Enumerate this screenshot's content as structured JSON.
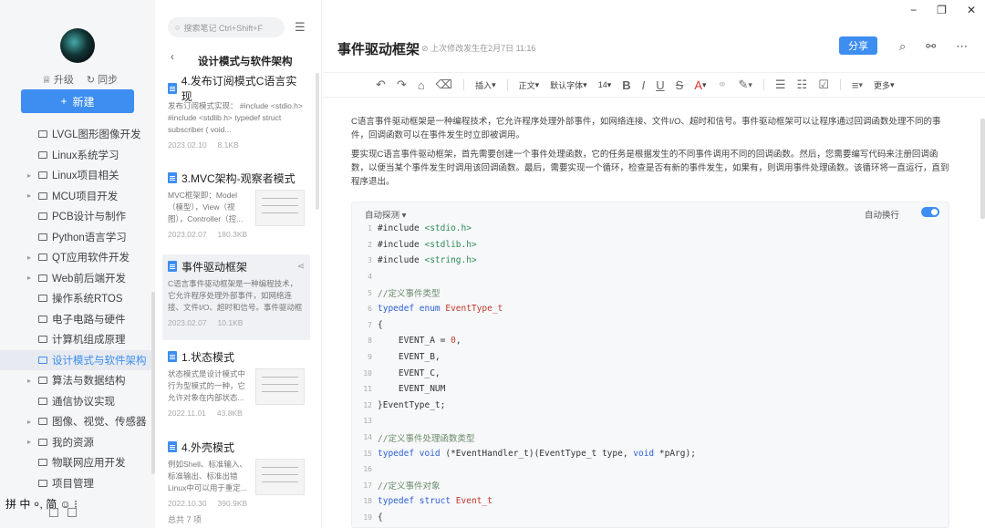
{
  "sidebar": {
    "upgrade": "升级",
    "sync": "同步",
    "new_button": "新建",
    "folders": [
      {
        "label": "LVGL图形图像开发",
        "expandable": false
      },
      {
        "label": "Linux系统学习",
        "expandable": false
      },
      {
        "label": "Linux项目相关",
        "expandable": true
      },
      {
        "label": "MCU项目开发",
        "expandable": true
      },
      {
        "label": "PCB设计与制作",
        "expandable": false
      },
      {
        "label": "Python语言学习",
        "expandable": false
      },
      {
        "label": "QT应用软件开发",
        "expandable": true
      },
      {
        "label": "Web前后端开发",
        "expandable": true
      },
      {
        "label": "操作系统RTOS",
        "expandable": false
      },
      {
        "label": "电子电路与硬件",
        "expandable": false
      },
      {
        "label": "计算机组成原理",
        "expandable": false
      },
      {
        "label": "设计模式与软件架构",
        "expandable": false,
        "active": true
      },
      {
        "label": "算法与数据结构",
        "expandable": true
      },
      {
        "label": "通信协议实现",
        "expandable": false
      },
      {
        "label": "图像、视觉、传感器",
        "expandable": true
      },
      {
        "label": "我的资源",
        "expandable": true
      },
      {
        "label": "物联网应用开发",
        "expandable": false
      },
      {
        "label": "项目管理",
        "expandable": false
      }
    ],
    "ime": "拼 中 ⸰, 简 ☺ ⁝"
  },
  "notelist": {
    "search_placeholder": "搜索笔记 Ctrl+Shift+F",
    "header": "设计模式与软件架构",
    "footer": "总共 7 项",
    "notes": [
      {
        "title": "4.发布订阅模式C语言实现",
        "snippet": "发布订阅模式实现： #include <stdio.h> #include <stdlib.h> typedef struct subscriber ( void...",
        "date": "2023.02.10",
        "size": "8.1KB",
        "thumb": false
      },
      {
        "title": "3.MVC架构-观察者模式",
        "snippet": "MVC框架即：Model（模型），View（视图），Controller（控...",
        "date": "2023.02.07",
        "size": "180.3KB",
        "thumb": true
      },
      {
        "title": "事件驱动框架",
        "snippet": "C语言事件驱动框架是一种编程技术，它允许程序处理外部事件，如网络连接、文件I/O、超时和信号。事件驱动框架可...",
        "date": "2023.02.07",
        "size": "10.1KB",
        "thumb": false,
        "active": true
      },
      {
        "title": "1.状态模式",
        "snippet": "状态模式是设计模式中行为型模式的一种，它允许对象在内部状态...",
        "date": "2022.11.01",
        "size": "43.8KB",
        "thumb": true
      },
      {
        "title": "4.外壳模式",
        "snippet": "例如Shell、标准输入、标准输出、标准出错 Linux中可以用于重定...",
        "date": "2022.10.30",
        "size": "390.9KB",
        "thumb": true
      }
    ]
  },
  "editor": {
    "title": "事件驱动框架",
    "modified": "上次修改发生在2月7日 11:16",
    "share": "分享",
    "toolbar": {
      "insert": "插入",
      "text": "正文",
      "font": "默认字体",
      "size": "14",
      "more": "更多"
    },
    "para1": "C语言事件驱动框架是一种编程技术，它允许程序处理外部事件，如网络连接、文件I/O、超时和信号。事件驱动框架可以让程序通过回调函数处理不同的事件，回调函数可以在事件发生时立即被调用。",
    "para2": "要实现C语言事件驱动框架，首先需要创建一个事件处理函数，它的任务是根据发生的不同事件调用不同的回调函数。然后，您需要编写代码来注册回调函数，以便当某个事件发生时调用该回调函数。最后，需要实现一个循环，检查是否有新的事件发生，如果有，则调用事件处理函数。该循环将一直运行，直到程序退出。",
    "code_lang": "自动探测",
    "code_wrap": "自动换行"
  }
}
